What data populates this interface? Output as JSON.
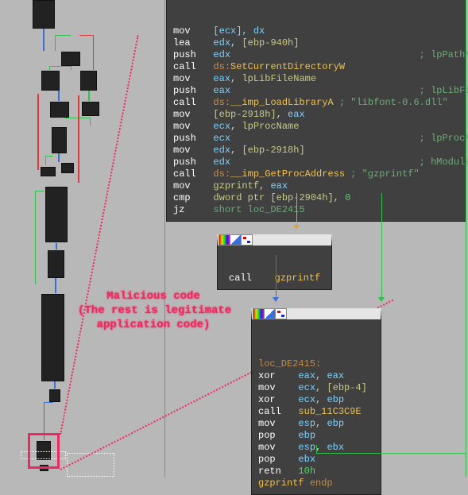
{
  "annotation": {
    "line1": "Malicious code",
    "line2": "(The rest is legitimate",
    "line3": "application code)"
  },
  "block1": {
    "lines": [
      {
        "mn": "mov",
        "args": "[ecx], dx"
      },
      {
        "mn": "lea",
        "op1": "edx",
        "mem": "[ebp-940h]"
      },
      {
        "mn": "push",
        "op1": "edx",
        "cm": "; lpPathName"
      },
      {
        "mn": "call",
        "ds": "ds:",
        "fn": "SetCurrentDirectoryW"
      },
      {
        "mn": "mov",
        "op1": "eax",
        "mem": "lpLibFileName"
      },
      {
        "mn": "push",
        "op1": "eax",
        "cm": "; lpLibFileName"
      },
      {
        "mn": "call",
        "ds": "ds:",
        "fn": "__imp_LoadLibraryA",
        "cm": " ; \"libfont-0.6.dll\""
      },
      {
        "mn": "mov",
        "mem": "[ebp-2918h]",
        "op2": "eax"
      },
      {
        "mn": "mov",
        "op1": "ecx",
        "mem": "lpProcName"
      },
      {
        "mn": "push",
        "op1": "ecx",
        "cm": "; lpProcName"
      },
      {
        "mn": "mov",
        "op1": "edx",
        "mem": "[ebp-2918h]"
      },
      {
        "mn": "push",
        "op1": "edx",
        "cm": "; hModule"
      },
      {
        "mn": "call",
        "ds": "ds:",
        "fn": "__imp_GetProcAddress",
        "cm": " ; \"gzprintf\""
      },
      {
        "mn": "mov",
        "mem": "gzprintf",
        "op2": "eax"
      },
      {
        "mn": "cmp",
        "mem": "dword ptr [ebp-2904h]",
        "num": "0"
      },
      {
        "mn": "jz",
        "tgt": "short loc_DE2415"
      }
    ]
  },
  "block2": {
    "mn": "call",
    "fn": "gzprintf"
  },
  "block3": {
    "label": "loc_DE2415:",
    "lines": [
      {
        "mn": "xor",
        "op1": "eax",
        "op2": "eax"
      },
      {
        "mn": "mov",
        "op1": "ecx",
        "mem": "[ebp-4]"
      },
      {
        "mn": "xor",
        "op1": "ecx",
        "op2": "ebp"
      },
      {
        "mn": "call",
        "fn": "sub_11C3C9E"
      },
      {
        "mn": "mov",
        "op1": "esp",
        "op2": "ebp"
      },
      {
        "mn": "pop",
        "op1": "ebp"
      },
      {
        "mn": "mov",
        "op1": "esp",
        "op2": "ebx"
      },
      {
        "mn": "pop",
        "op1": "ebx"
      },
      {
        "mn": "retn",
        "num": "10h"
      }
    ],
    "endp": {
      "fn": "gzprintf",
      "kw": "endp"
    }
  }
}
